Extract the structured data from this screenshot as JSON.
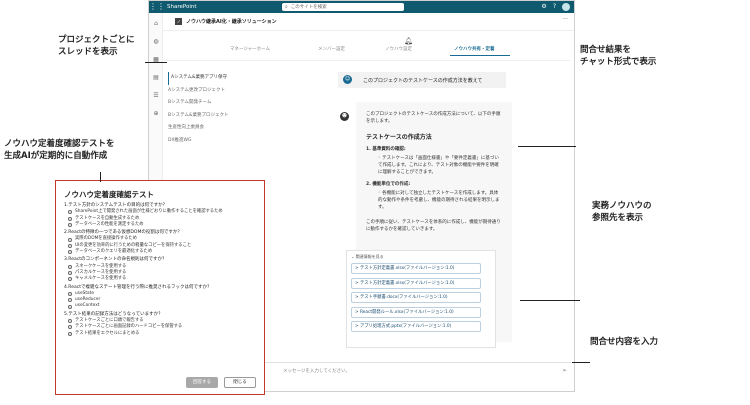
{
  "topbar": {
    "brand": "SharePoint",
    "search_placeholder": "このサイトを検索"
  },
  "site": {
    "logo": "ノ",
    "title": "ノウハウ継承AI化・継承ソリューション"
  },
  "tabs": [
    {
      "label": "マネージャーホーム"
    },
    {
      "label": "メンバー設定"
    },
    {
      "label": "ノウハウ設定"
    },
    {
      "label": "ノウハウ共有・定着"
    }
  ],
  "projects": [
    "Aシステム&業務アプリ保守",
    "Aシステム更改プロジェクト",
    "Bシステム開発チーム",
    "Bシステム&業務プロジェクト",
    "生産性向上委員会",
    "DX推進WG"
  ],
  "chat": {
    "user_question": "このプロジェクトのテストケースの作成方法を教えて",
    "answer_intro": "このプロジェクトのテストケースの作成方法について、以下の手順を示します。",
    "answer_heading": "テストケースの作成方法",
    "step1_title": "1. 基準資料の確認:",
    "step1_text": "テストケースは「画面仕様書」や「要件定義書」に基づいて作成します。これにより、テスト対象の機能や要件を明確に理解することができます。",
    "step2_title": "2. 機能単位での作成:",
    "step2_text": "各機能に対して独立したテストケースを作成します。具体的な動作や条件を考慮し、機能の期待される結果を明示します。",
    "answer_footer": "この手順に従い、テストケースを体系的に作成し、機能が期待通りに動作するかを確認していきます。",
    "refs_title": "関連情報を見る",
    "refs": [
      "テスト方針定義書.xlsx(ファイルバージョン:1.0)",
      "テスト方針定義書.xlsx(ファイルバージョン:1.0)",
      "テスト手順書.docx(ファイルバージョン:1.0)",
      "React開発ルール.xlsx(ファイルバージョン:1.0)",
      "アプリ処理方式.pptx(ファイルバージョン:1.0)"
    ],
    "input_placeholder": "メッセージを入力してください。"
  },
  "quiz": {
    "title": "ノウハウ定着度確認テスト",
    "questions": [
      {
        "q": "1.テスト方針のシステムテストの目的は何ですか？",
        "options": [
          "SharePoint上で開発された画面が仕様どおりに動作することを確認するため",
          "テストケースを自動生成するため",
          "データベースの性能を測定するため"
        ]
      },
      {
        "q": "2.Reactの特徴の一つである仮想DOMの役割は何ですか？",
        "options": [
          "実際のDOMを直接操作するため",
          "UIの変更を効率的に行うための軽量なコピーを保持すること",
          "データベースのクエリを最適化するため"
        ]
      },
      {
        "q": "3.Reactのコンポーネントの命名規則は何ですか？",
        "options": [
          "スネークケースを使用する",
          "パスカルケースを使用する",
          "キャメルケースを使用する"
        ]
      },
      {
        "q": "4.Reactで複雑なステート管理を行う際に推奨されるフックは何ですか？",
        "options": [
          "useState",
          "useReducer",
          "useContext"
        ]
      },
      {
        "q": "5.テスト結果の記録方法はどうなっていますか？",
        "options": [
          "テストケースごとに口頭で報告する",
          "テストケースごとに画面記録のハードコピーを保管する",
          "テスト結果をエクセルにまとめる"
        ]
      }
    ],
    "answer_button": "回答する",
    "close_button": "閉じる"
  },
  "annotations": {
    "thread": [
      "プロジェクトごとに",
      "スレッドを表示"
    ],
    "quiz": [
      "ノウハウ定着度確認テストを",
      "生成AIが定期的に自動作成"
    ],
    "chat": [
      "問合せ結果を",
      "チャット形式で表示"
    ],
    "refs": [
      "実務ノウハウの",
      "参照先を表示"
    ],
    "input": [
      "問合せ内容を入力"
    ]
  }
}
